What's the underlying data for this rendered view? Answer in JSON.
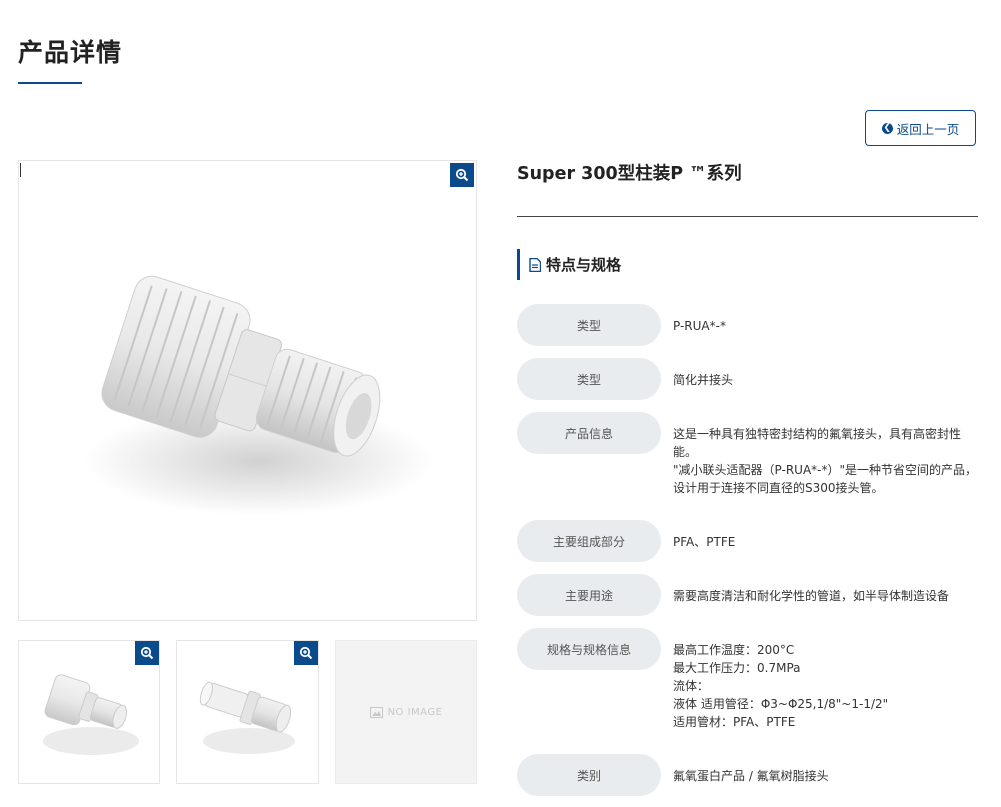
{
  "page": {
    "title": "产品详情"
  },
  "back_button": {
    "label": "返回上一页"
  },
  "product": {
    "title": "Super 300型柱装P ™系列"
  },
  "gallery": {
    "no_image_label": "NO IMAGE"
  },
  "section": {
    "title": "特点与规格"
  },
  "specs": [
    {
      "label": "类型",
      "value": [
        "P-RUA*-*"
      ]
    },
    {
      "label": "类型",
      "value": [
        "简化并接头"
      ]
    },
    {
      "label": "产品信息",
      "value": [
        "这是一种具有独特密封结构的氟氧接头，具有高密封性能。",
        "\"减小联头适配器（P-RUA*-*）\"是一种节省空间的产品，设计用于连接不同直径的S300接头管。"
      ]
    },
    {
      "label": "主要组成部分",
      "value": [
        "PFA、PTFE"
      ]
    },
    {
      "label": "主要用途",
      "value": [
        "需要高度清洁和耐化学性的管道，如半导体制造设备"
      ]
    },
    {
      "label": "规格与规格信息",
      "value": [
        "最高工作温度：200°C",
        "最大工作压力：0.7MPa",
        "流体：",
        "液体 适用管径：Φ3~Φ25,1/8\"~1-1/2\"",
        "适用管材：PFA、PTFE"
      ]
    },
    {
      "label": "类别",
      "value": [
        "氟氧蛋白产品 / 氟氧树脂接头"
      ]
    }
  ],
  "colors": {
    "accent": "#0b4a8b",
    "label_bg": "#e9ecef"
  }
}
